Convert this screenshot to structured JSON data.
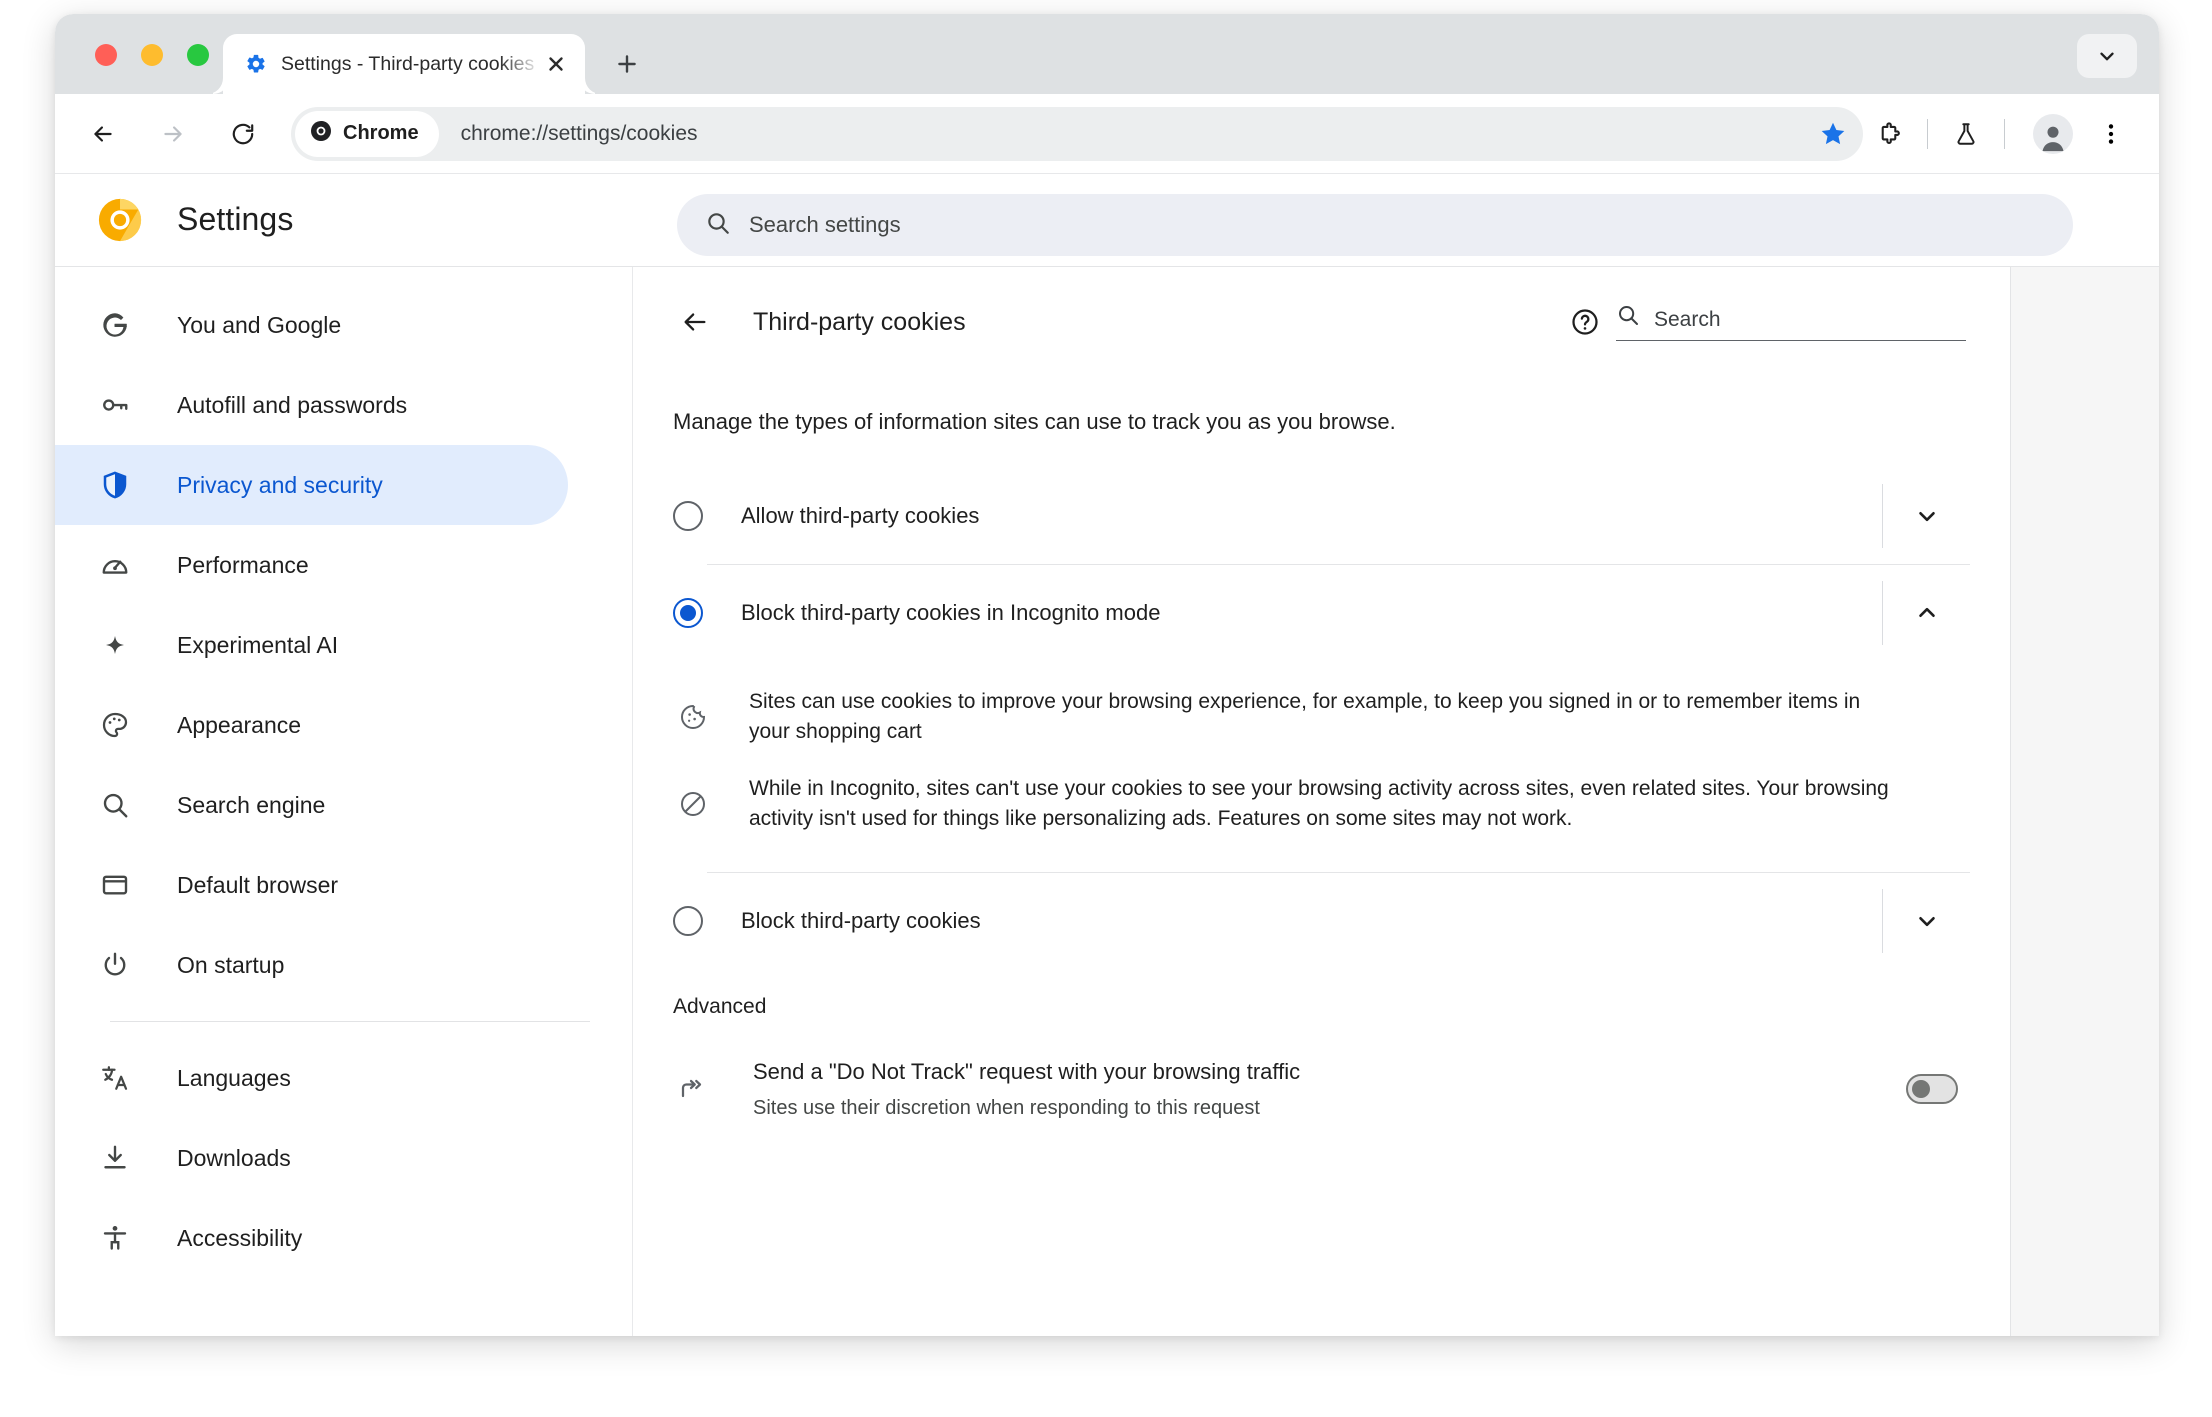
{
  "window": {
    "tab": {
      "title": "Settings - Third-party cookies",
      "favicon_icon": "gear-icon",
      "close_icon": "close-icon"
    },
    "new_tab_icon": "plus-icon",
    "tab_search_icon": "chevron-down-icon",
    "traffic_lights": [
      "close-red",
      "minimize-yellow",
      "zoom-green"
    ]
  },
  "toolbar": {
    "back_icon": "arrow-left-icon",
    "forward_icon": "arrow-right-icon",
    "reload_icon": "reload-icon",
    "chip_label": "Chrome",
    "chip_icon": "chrome-shield-icon",
    "url": "chrome://settings/cookies",
    "bookmark_icon": "star-filled-icon",
    "bookmark_color": "#1a73e8",
    "extensions_icon": "puzzle-piece-icon",
    "experiments_icon": "flask-icon",
    "profile_icon": "person-avatar-icon",
    "menu_icon": "three-dot-menu-icon"
  },
  "settings_header": {
    "logo_icon": "chrome-canary-logo",
    "title": "Settings",
    "search": {
      "icon": "search-icon",
      "placeholder": "Search settings",
      "value": ""
    }
  },
  "sidebar": {
    "groups": [
      {
        "items": [
          {
            "label": "You and Google",
            "icon": "google-g-icon",
            "active": false
          },
          {
            "label": "Autofill and passwords",
            "icon": "key-icon",
            "active": false
          },
          {
            "label": "Privacy and security",
            "icon": "shield-icon",
            "active": true
          },
          {
            "label": "Performance",
            "icon": "speedometer-icon",
            "active": false
          },
          {
            "label": "Experimental AI",
            "icon": "sparkle-icon",
            "active": false
          },
          {
            "label": "Appearance",
            "icon": "palette-icon",
            "active": false
          },
          {
            "label": "Search engine",
            "icon": "search-icon",
            "active": false
          },
          {
            "label": "Default browser",
            "icon": "browser-window-icon",
            "active": false
          },
          {
            "label": "On startup",
            "icon": "power-icon",
            "active": false
          }
        ]
      },
      {
        "items": [
          {
            "label": "Languages",
            "icon": "translate-icon",
            "active": false
          },
          {
            "label": "Downloads",
            "icon": "download-icon",
            "active": false
          },
          {
            "label": "Accessibility",
            "icon": "accessibility-icon",
            "active": false
          }
        ]
      }
    ],
    "active_pill_color": "#e1ecfd",
    "active_text_color": "#0b57d0"
  },
  "main": {
    "back_icon": "arrow-left-icon",
    "title": "Third-party cookies",
    "help_icon": "help-circle-icon",
    "search": {
      "icon": "search-icon",
      "placeholder": "Search",
      "value": ""
    },
    "intro": "Manage the types of information sites can use to track you as you browse.",
    "options": [
      {
        "label": "Allow third-party cookies",
        "selected": false,
        "expanded": false,
        "expander_icon": "chevron-down-icon"
      },
      {
        "label": "Block third-party cookies in Incognito mode",
        "selected": true,
        "expanded": true,
        "expander_icon": "chevron-up-icon",
        "details": [
          {
            "icon": "cookie-icon",
            "text": "Sites can use cookies to improve your browsing experience, for example, to keep you signed in or to remember items in your shopping cart"
          },
          {
            "icon": "block-circle-slash-icon",
            "text": "While in Incognito, sites can't use your cookies to see your browsing activity across sites, even related sites. Your browsing activity isn't used for things like personalizing ads. Features on some sites may not work."
          }
        ]
      },
      {
        "label": "Block third-party cookies",
        "selected": false,
        "expanded": false,
        "expander_icon": "chevron-down-icon"
      }
    ],
    "advanced": {
      "section_title": "Advanced",
      "rows": [
        {
          "icon": "do-not-track-arrows-icon",
          "primary": "Send a \"Do Not Track\" request with your browsing traffic",
          "secondary": "Sites use their discretion when responding to this request",
          "toggle_on": false
        }
      ]
    }
  }
}
